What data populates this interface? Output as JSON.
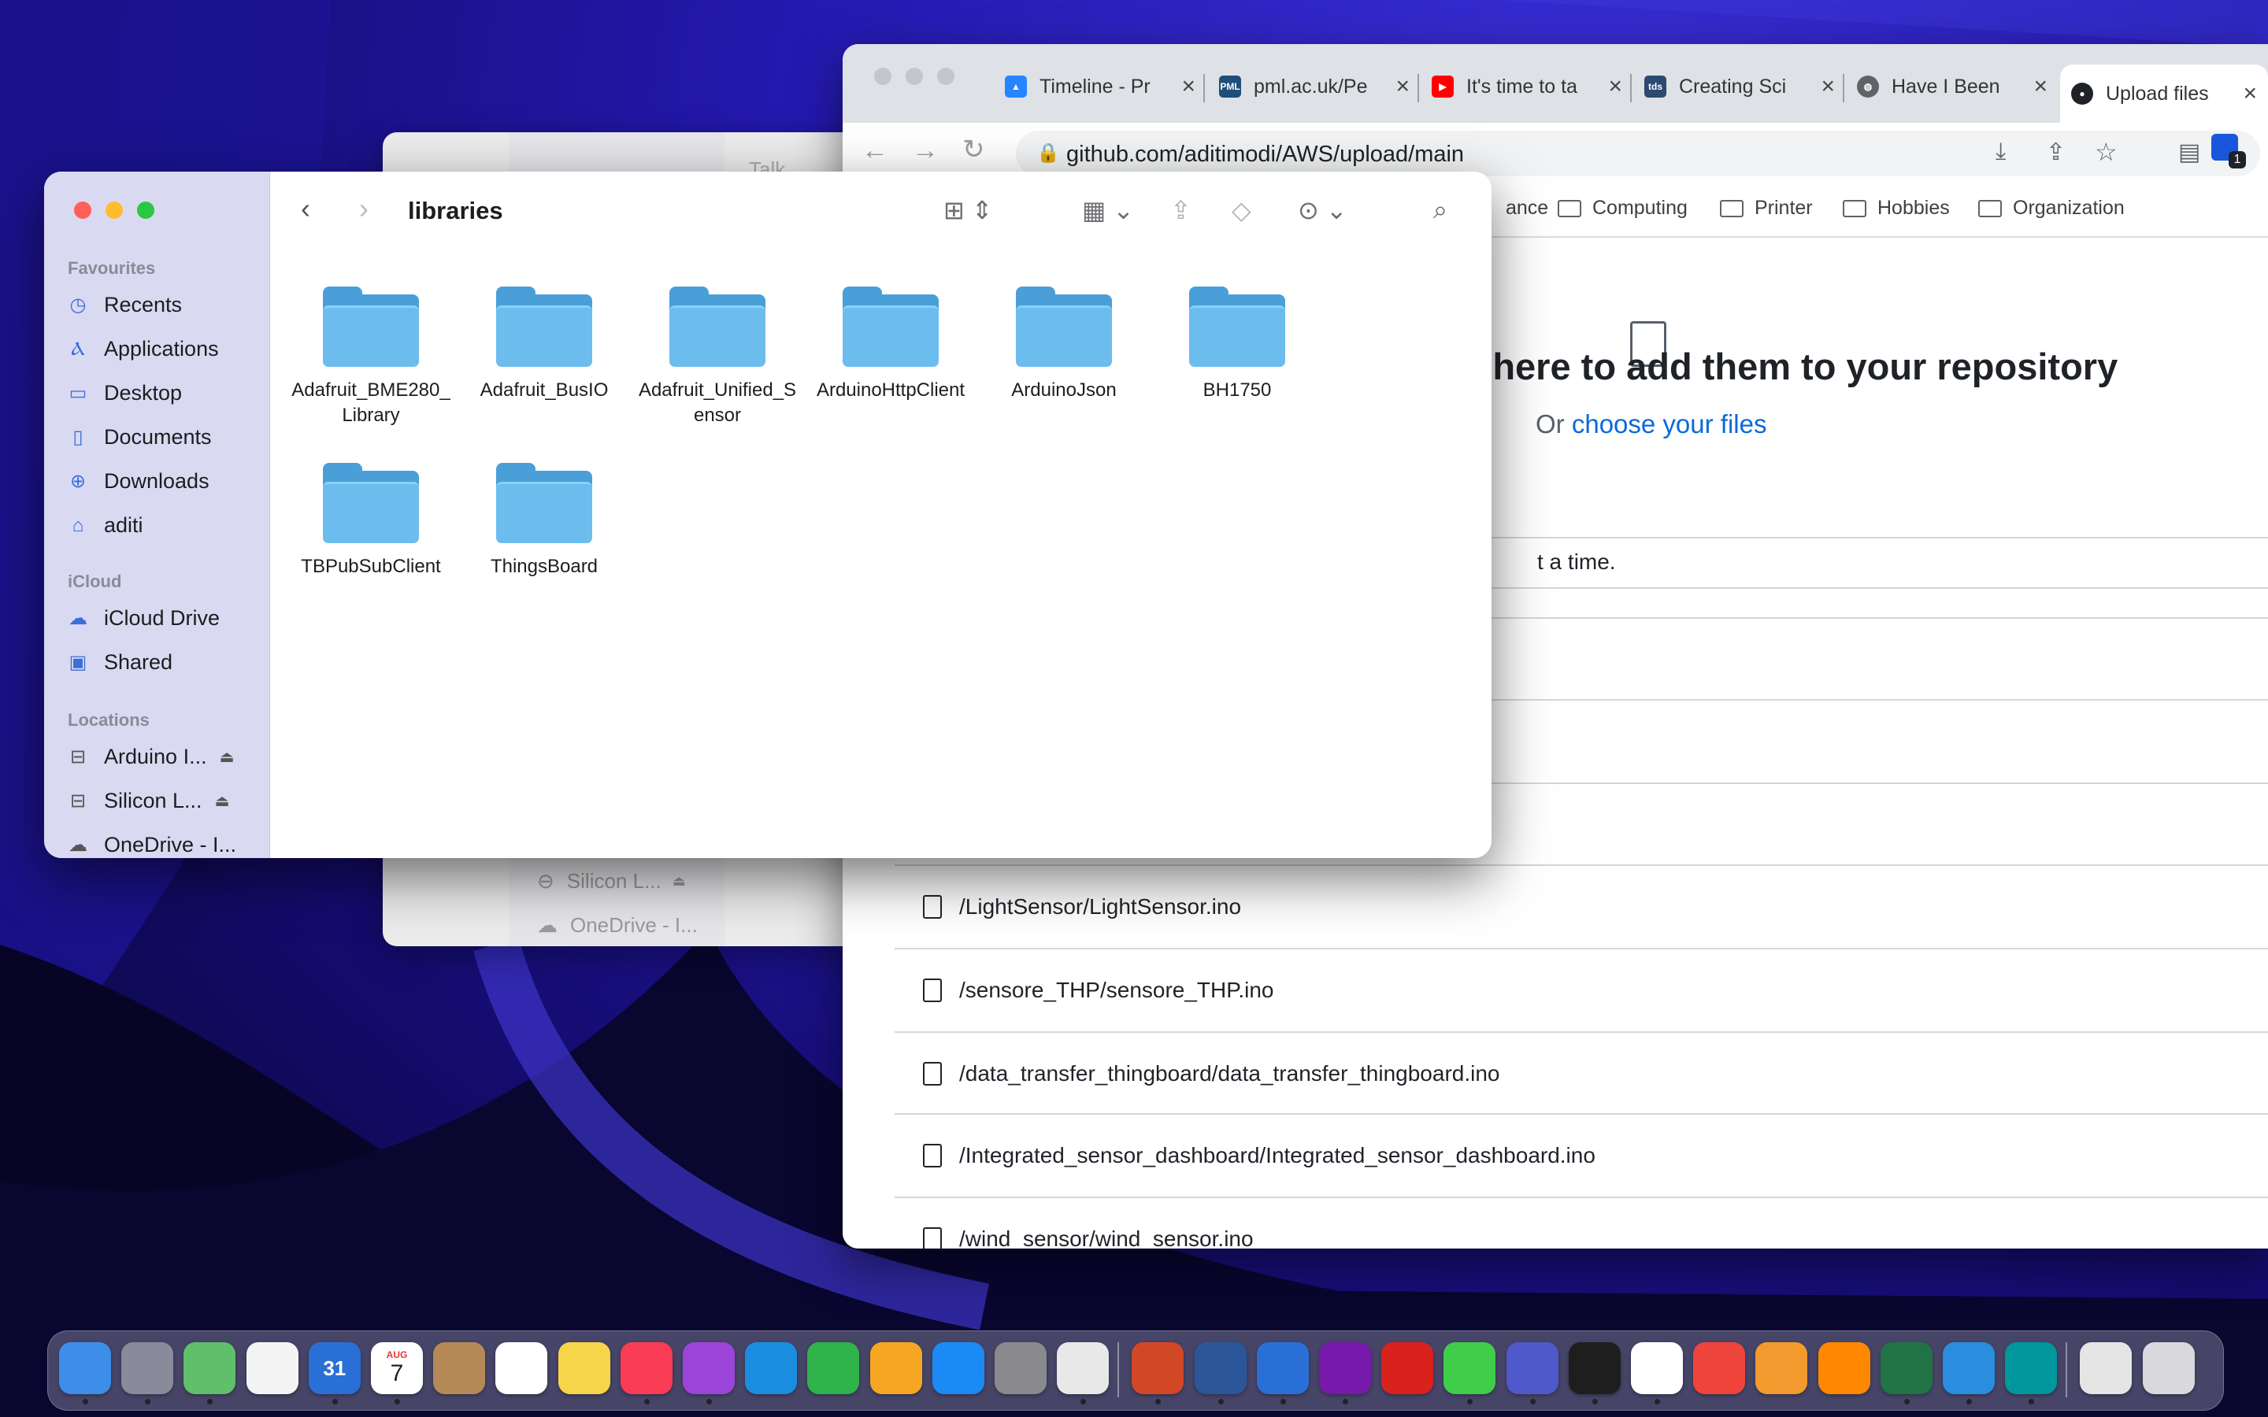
{
  "browser": {
    "tabs": [
      {
        "title": "Timeline - Pr",
        "icon": "jira-icon",
        "color": "#2684ff"
      },
      {
        "title": "pml.ac.uk/Pe",
        "icon": "pml-icon",
        "color": "#1f4e79"
      },
      {
        "title": "It's time to ta",
        "icon": "youtube-icon",
        "color": "#ff0000"
      },
      {
        "title": "Creating Sci",
        "icon": "tds-icon",
        "color": "#2b4a6f"
      },
      {
        "title": "Have I Been",
        "icon": "globe-icon",
        "color": "#5f6368"
      },
      {
        "title": "Upload files",
        "icon": "github-icon",
        "color": "#1f2328"
      }
    ],
    "url": "github.com/aditimodi/AWS/upload/main",
    "extension_badge": "1",
    "bookmarks": [
      "ance",
      "Computing",
      "Printer",
      "Hobbies",
      "Organization"
    ],
    "upload": {
      "title": "es here to add them to your repository",
      "sub_prefix": "Or",
      "choose_link": "choose your files",
      "notice": "t a time."
    },
    "files": [
      "/LightSensor/LightSensor.ino",
      "/sensore_THP/sensore_THP.ino",
      "/data_transfer_thingboard/data_transfer_thingboard.ino",
      "/Integrated_sensor_dashboard/Integrated_sensor_dashboard.ino",
      "/wind_sensor/wind_sensor.ino"
    ]
  },
  "bg_finder": {
    "title": "Talk",
    "items": [
      "Silicon L...",
      "OneDrive - I..."
    ]
  },
  "finder": {
    "title": "libraries",
    "sidebar": {
      "favourites_label": "Favourites",
      "favourites": [
        {
          "label": "Recents",
          "icon": "clock-icon"
        },
        {
          "label": "Applications",
          "icon": "applications-icon"
        },
        {
          "label": "Desktop",
          "icon": "desktop-icon"
        },
        {
          "label": "Documents",
          "icon": "document-icon"
        },
        {
          "label": "Downloads",
          "icon": "download-icon"
        },
        {
          "label": "aditi",
          "icon": "home-icon"
        }
      ],
      "icloud_label": "iCloud",
      "icloud": [
        {
          "label": "iCloud Drive",
          "icon": "cloud-icon"
        },
        {
          "label": "Shared",
          "icon": "shared-folder-icon"
        }
      ],
      "locations_label": "Locations",
      "locations": [
        {
          "label": "Arduino I...",
          "icon": "drive-icon"
        },
        {
          "label": "Silicon L...",
          "icon": "drive-icon"
        },
        {
          "label": "OneDrive - I...",
          "icon": "cloud-icon"
        }
      ]
    },
    "folders": [
      "Adafruit_BME280_Library",
      "Adafruit_BusIO",
      "Adafruit_Unified_Sensor",
      "ArduinoHttpClient",
      "ArduinoJson",
      "BH1750",
      "TBPubSubClient",
      "ThingsBoard"
    ]
  },
  "dock": {
    "calendar_month": "AUG",
    "calendar_day": "7",
    "calendar_num": "31",
    "apps": [
      {
        "name": "finder",
        "color": "#3d8ee8"
      },
      {
        "name": "launchpad",
        "color": "#8a8a9a"
      },
      {
        "name": "maps",
        "color": "#5fbf6b"
      },
      {
        "name": "photos",
        "color": "#f4f4f4"
      },
      {
        "name": "calendar",
        "color": "#2a6fd6"
      },
      {
        "name": "reminders-calendar",
        "color": "#ffffff"
      },
      {
        "name": "contacts",
        "color": "#b58a57"
      },
      {
        "name": "reminders",
        "color": "#ffffff"
      },
      {
        "name": "notes",
        "color": "#f7d54a"
      },
      {
        "name": "music",
        "color": "#fa3c55"
      },
      {
        "name": "podcasts",
        "color": "#9b45d8"
      },
      {
        "name": "keynote",
        "color": "#1a8de0"
      },
      {
        "name": "numbers",
        "color": "#2fb34a"
      },
      {
        "name": "pages",
        "color": "#f5a623"
      },
      {
        "name": "app-store",
        "color": "#1b8af5"
      },
      {
        "name": "system-preferences",
        "color": "#8a8a8e"
      },
      {
        "name": "chrome",
        "color": "#e8e8e8"
      },
      {
        "name": "powerpoint",
        "color": "#d24726"
      },
      {
        "name": "word",
        "color": "#2b579a"
      },
      {
        "name": "defender",
        "color": "#2a6fd6"
      },
      {
        "name": "onenote",
        "color": "#7719aa"
      },
      {
        "name": "acrobat",
        "color": "#d9221c"
      },
      {
        "name": "messages",
        "color": "#3fcd4a"
      },
      {
        "name": "teams",
        "color": "#5059c9"
      },
      {
        "name": "terminal",
        "color": "#1e1e1e"
      },
      {
        "name": "slack",
        "color": "#ffffff"
      },
      {
        "name": "anydesk",
        "color": "#ef443b"
      },
      {
        "name": "books",
        "color": "#f29a2e"
      },
      {
        "name": "vlc",
        "color": "#ff8800"
      },
      {
        "name": "excel",
        "color": "#217346"
      },
      {
        "name": "vscode",
        "color": "#2a8de0"
      },
      {
        "name": "arduino",
        "color": "#00979d"
      },
      {
        "name": "preview-doc",
        "color": "#e5e5e5"
      },
      {
        "name": "trash",
        "color": "#d9d9dd"
      }
    ]
  }
}
